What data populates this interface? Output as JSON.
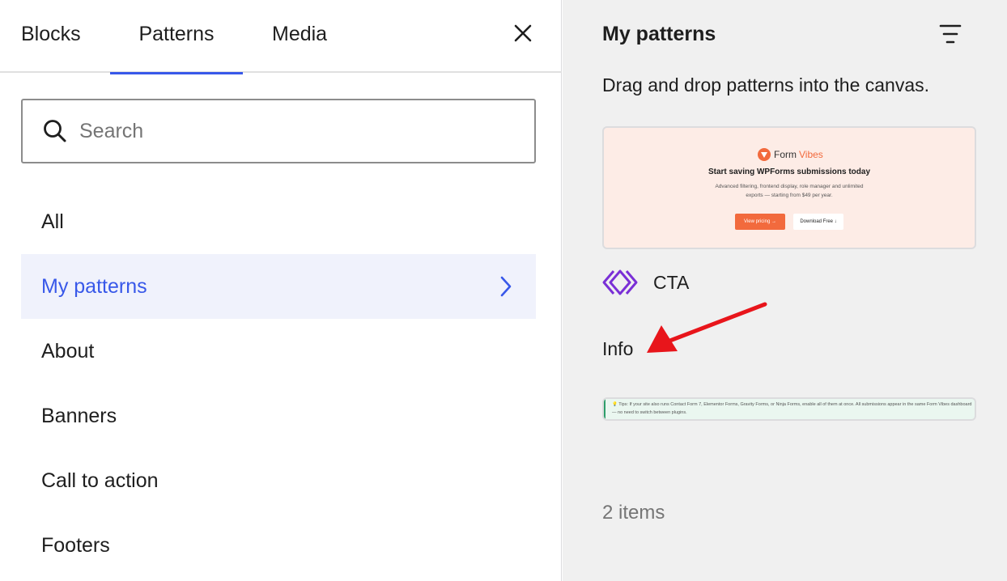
{
  "tabs": {
    "blocks": "Blocks",
    "patterns": "Patterns",
    "media": "Media"
  },
  "search": {
    "placeholder": "Search"
  },
  "categories": [
    {
      "label": "All"
    },
    {
      "label": "My patterns"
    },
    {
      "label": "About"
    },
    {
      "label": "Banners"
    },
    {
      "label": "Call to action"
    },
    {
      "label": "Footers"
    }
  ],
  "panel": {
    "title": "My patterns",
    "description": "Drag and drop patterns into the canvas.",
    "count": "2 items"
  },
  "patterns": [
    {
      "name": "CTA",
      "preview": {
        "logo_a": "Form",
        "logo_b": "Vibes",
        "heading": "Start saving WPForms submissions today",
        "subtext": "Advanced filtering, frontend display, role manager and unlimited exports — starting from $49 per year.",
        "primary_button": "View pricing →",
        "secondary_button": "Download Free ↓"
      }
    },
    {
      "name": "Info",
      "preview": {
        "tip": "💡 Tips: If your site also runs Contact Form 7, Elementor Forms, Gravity Forms, or Ninja Forms, enable all of them at once. All submissions appear in the same Form Vibes dashboard — no need to switch between plugins."
      }
    }
  ],
  "colors": {
    "accent": "#3858e9",
    "brand_orange": "#f26a3d",
    "arrow": "#e8151b",
    "pattern_icon": "#7a2fd6"
  }
}
